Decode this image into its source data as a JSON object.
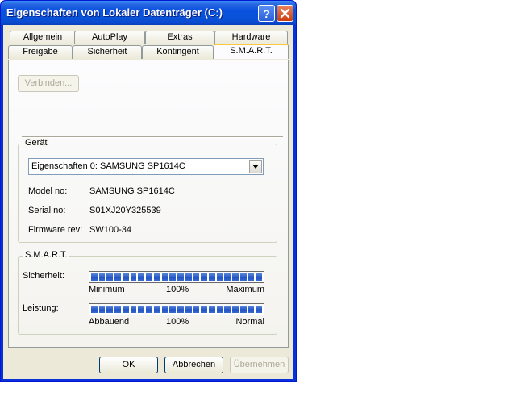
{
  "window": {
    "title": "Eigenschaften von Lokaler Datenträger (C:)",
    "help_icon": "?",
    "close_icon": "✕"
  },
  "tabs": {
    "row1": [
      "Allgemein",
      "AutoPlay",
      "Extras",
      "Hardware"
    ],
    "row2": [
      "Freigabe",
      "Sicherheit",
      "Kontingent",
      "S.M.A.R.T."
    ],
    "active": "S.M.A.R.T."
  },
  "connect_button": "Verbinden...",
  "device": {
    "group_label": "Gerät",
    "selected": "Eigenschaften 0: SAMSUNG SP1614C",
    "fields": [
      {
        "label": "Model no:",
        "value": "SAMSUNG SP1614C"
      },
      {
        "label": "Serial no:",
        "value": "S01XJ20Y325539"
      },
      {
        "label": "Firmware rev:",
        "value": "SW100-34"
      }
    ]
  },
  "smart": {
    "group_label": "S.M.A.R.T.",
    "bars": [
      {
        "label": "Sicherheit:",
        "level_percent": 100,
        "min": "Minimum",
        "mid": "100%",
        "max": "Maximum"
      },
      {
        "label": "Leistung:",
        "level_percent": 100,
        "min": "Abbauend",
        "mid": "100%",
        "max": "Normal"
      }
    ]
  },
  "footer": {
    "ok": "OK",
    "cancel": "Abbrechen",
    "apply": "Übernehmen"
  },
  "colors": {
    "titlebar": "#0a51e0",
    "progress_fill": "#2255c4",
    "active_tab_accent": "#ffc83c",
    "face": "#ece9d8"
  }
}
